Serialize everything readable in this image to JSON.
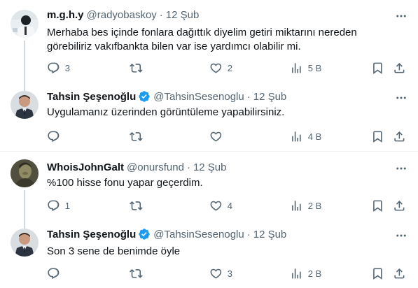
{
  "tweets": [
    {
      "name": "m.g.h.y",
      "handle": "@radyobaskoy",
      "separator": "·",
      "time": "12 Şub",
      "verified": false,
      "text_lines": [
        "Merhaba bes içinde fonlara dağıttık diyelim getiri miktarını nereden",
        "görebiliriz vakıfbankta bilen var ise yardımcı olabilir mi."
      ],
      "replies": "3",
      "retweets": "",
      "likes": "2",
      "views": "5 B"
    },
    {
      "name": "Tahsin Şeşenoğlu",
      "handle": "@TahsinSesenoglu",
      "separator": "·",
      "time": "12 Şub",
      "verified": true,
      "text_lines": [
        "Uygulamanız üzerinden görüntüleme yapabilirsiniz."
      ],
      "replies": "",
      "retweets": "",
      "likes": "",
      "views": "4 B"
    },
    {
      "name": "WhoisJohnGalt",
      "handle": "@onursfund",
      "separator": "·",
      "time": "12 Şub",
      "verified": false,
      "text_lines": [
        "%100 hisse fonu yapar geçerdim."
      ],
      "replies": "1",
      "retweets": "",
      "likes": "4",
      "views": "2 B"
    },
    {
      "name": "Tahsin Şeşenoğlu",
      "handle": "@TahsinSesenoglu",
      "separator": "·",
      "time": "12 Şub",
      "verified": true,
      "text_lines": [
        "Son 3 sene de benimde öyle"
      ],
      "replies": "",
      "retweets": "",
      "likes": "3",
      "views": "2 B"
    }
  ],
  "icons": {
    "more": "more-dots-icon",
    "reply": "reply-icon",
    "retweet": "retweet-icon",
    "like": "like-icon",
    "views": "views-icon",
    "bookmark": "bookmark-icon",
    "share": "share-icon",
    "verified": "verified-badge-icon"
  },
  "colors": {
    "text": "#0f1419",
    "secondary": "#536471",
    "verified": "#1d9bf0",
    "divider": "#eff3f4",
    "thread_line": "#cfd9de"
  }
}
